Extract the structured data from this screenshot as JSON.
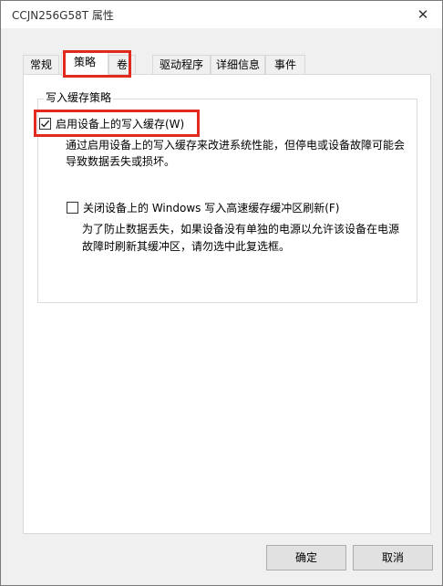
{
  "window": {
    "title": "CCJN256G58T 属性",
    "close_glyph": "✕"
  },
  "tabs": [
    "常规",
    "策略",
    "卷",
    "驱动程序",
    "详细信息",
    "事件"
  ],
  "active_tab": "策略",
  "group": {
    "title": "写入缓存策略",
    "option1": {
      "label": "启用设备上的写入缓存(W)",
      "checked": true,
      "desc1": "通过启用设备上的写入缓存来改进系统性能，但停电或设备故障可能会",
      "desc2": "导致数据丢失或损坏。"
    },
    "option2": {
      "label": "关闭设备上的 Windows 写入高速缓存缓冲区刷新(F)",
      "checked": false,
      "desc1": "为了防止数据丢失，如果设备没有单独的电源以允许该设备在电源",
      "desc2": "故障时刷新其缓冲区，请勿选中此复选框。"
    }
  },
  "buttons": {
    "ok": "确定",
    "cancel": "取消"
  },
  "colors": {
    "highlight": "#e02a20",
    "desktop": "#1565c0"
  }
}
